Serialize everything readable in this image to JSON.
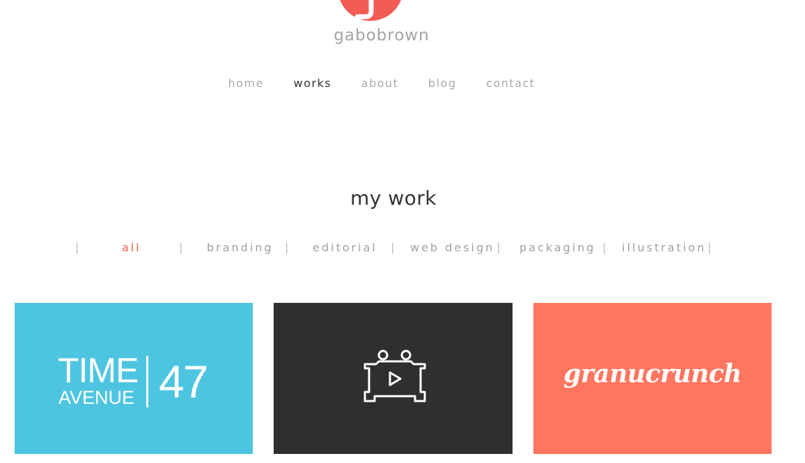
{
  "brand": {
    "name": "gabobrown",
    "accent_color": "#f25c54"
  },
  "nav": {
    "items": [
      {
        "label": "home",
        "active": false
      },
      {
        "label": "works",
        "active": true
      },
      {
        "label": "about",
        "active": false
      },
      {
        "label": "blog",
        "active": false
      },
      {
        "label": "contact",
        "active": false
      }
    ]
  },
  "section": {
    "title": "my work"
  },
  "filters": {
    "separator": "|",
    "items": [
      {
        "label": "all",
        "active": true
      },
      {
        "label": "branding",
        "active": false
      },
      {
        "label": "editorial",
        "active": false
      },
      {
        "label": "web design",
        "active": false
      },
      {
        "label": "packaging",
        "active": false
      },
      {
        "label": "illustration",
        "active": false
      }
    ]
  },
  "works": [
    {
      "name": "time-avenue-47",
      "background": "#4ec5e0",
      "logo_line1": "TIME",
      "logo_line2": "AVENUE",
      "logo_number": "47"
    },
    {
      "name": "video-character",
      "background": "#2f2f2f",
      "icon": "play-character-icon"
    },
    {
      "name": "granucrunch",
      "background": "#ff755f",
      "logo_text": "granucrunch"
    }
  ]
}
